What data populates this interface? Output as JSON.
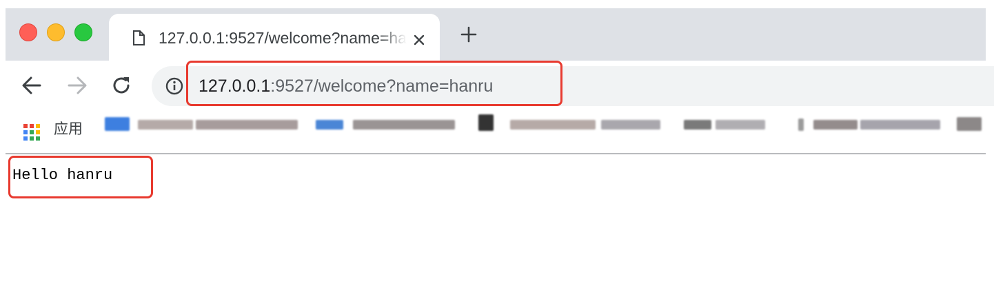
{
  "window": {
    "controls": [
      "close",
      "minimize",
      "zoom"
    ],
    "colors": {
      "close": "#ff5f57",
      "minimize": "#febc2e",
      "zoom": "#28c840"
    }
  },
  "tab": {
    "title": "127.0.0.1:9527/welcome?name=hanru",
    "favicon": "page-icon",
    "close_icon": "close-icon"
  },
  "new_tab_icon": "plus-icon",
  "toolbar": {
    "back_icon": "back-arrow-icon",
    "forward_icon": "forward-arrow-icon",
    "reload_icon": "reload-icon"
  },
  "omnibox": {
    "security_icon": "info-icon",
    "url_host": "127.0.0.1",
    "url_rest": ":9527/welcome?name=hanru"
  },
  "bookmarks": {
    "apps_label": "应用",
    "apps_icon": "apps-grid-icon"
  },
  "page": {
    "body_text": "Hello hanru"
  },
  "annotations": {
    "highlight_color": "#e83a2f"
  }
}
